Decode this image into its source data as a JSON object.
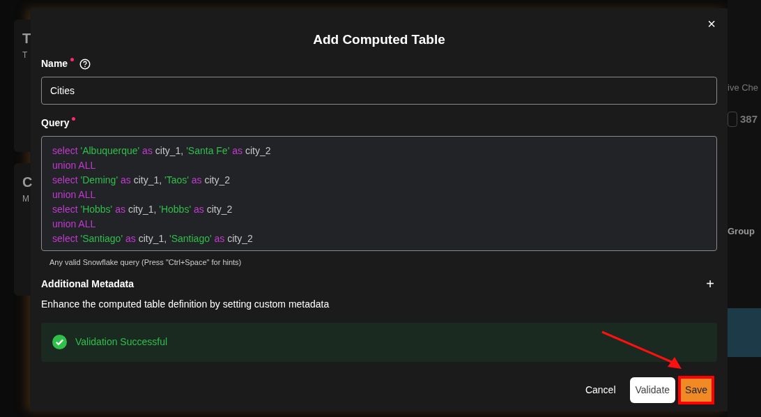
{
  "background": {
    "left_cards": [
      {
        "title": "T",
        "subtitle": "T"
      },
      {
        "title": "C",
        "subtitle": "M"
      }
    ],
    "right": {
      "header": "ive Che",
      "count": "387",
      "row_label": "Group"
    }
  },
  "dialog": {
    "title": "Add Computed Table",
    "close": "×",
    "name": {
      "label": "Name",
      "required": true,
      "value": "Cities"
    },
    "query": {
      "label": "Query",
      "required": true,
      "hint": "Any valid Snowflake query (Press \"Ctrl+Space\" for hints)",
      "lines": [
        [
          {
            "kind": "keyword",
            "text": "select"
          },
          {
            "kind": "string",
            "text": "'Albuquerque'"
          },
          {
            "kind": "keyword",
            "text": "as"
          },
          {
            "kind": "ident",
            "text": "city_1,"
          },
          {
            "kind": "string",
            "text": "'Santa Fe'"
          },
          {
            "kind": "keyword",
            "text": "as"
          },
          {
            "kind": "ident",
            "text": "city_2"
          }
        ],
        [
          {
            "kind": "keyword",
            "text": "union ALL"
          }
        ],
        [
          {
            "kind": "keyword",
            "text": "select"
          },
          {
            "kind": "string",
            "text": "'Deming'"
          },
          {
            "kind": "keyword",
            "text": "as"
          },
          {
            "kind": "ident",
            "text": "city_1,"
          },
          {
            "kind": "string",
            "text": "'Taos'"
          },
          {
            "kind": "keyword",
            "text": "as"
          },
          {
            "kind": "ident",
            "text": "city_2"
          }
        ],
        [
          {
            "kind": "keyword",
            "text": "union ALL"
          }
        ],
        [
          {
            "kind": "keyword",
            "text": "select"
          },
          {
            "kind": "string",
            "text": "'Hobbs'"
          },
          {
            "kind": "keyword",
            "text": "as"
          },
          {
            "kind": "ident",
            "text": "city_1,"
          },
          {
            "kind": "string",
            "text": "'Hobbs'"
          },
          {
            "kind": "keyword",
            "text": "as"
          },
          {
            "kind": "ident",
            "text": "city_2"
          }
        ],
        [
          {
            "kind": "keyword",
            "text": "union ALL"
          }
        ],
        [
          {
            "kind": "keyword",
            "text": "select"
          },
          {
            "kind": "string",
            "text": "'Santiago'"
          },
          {
            "kind": "keyword",
            "text": "as"
          },
          {
            "kind": "ident",
            "text": "city_1,"
          },
          {
            "kind": "string",
            "text": "'Santiago'"
          },
          {
            "kind": "keyword",
            "text": "as"
          },
          {
            "kind": "ident",
            "text": "city_2"
          }
        ]
      ]
    },
    "metadata": {
      "title": "Additional Metadata",
      "add": "+",
      "description": "Enhance the computed table definition by setting custom metadata"
    },
    "validation": {
      "message": "Validation Successful",
      "success": true
    },
    "buttons": [
      {
        "kind": "text",
        "label": "Cancel",
        "highlighted": false
      },
      {
        "kind": "outline",
        "label": "Validate",
        "highlighted": false
      },
      {
        "kind": "primary",
        "label": "Save",
        "highlighted": true
      }
    ]
  }
}
